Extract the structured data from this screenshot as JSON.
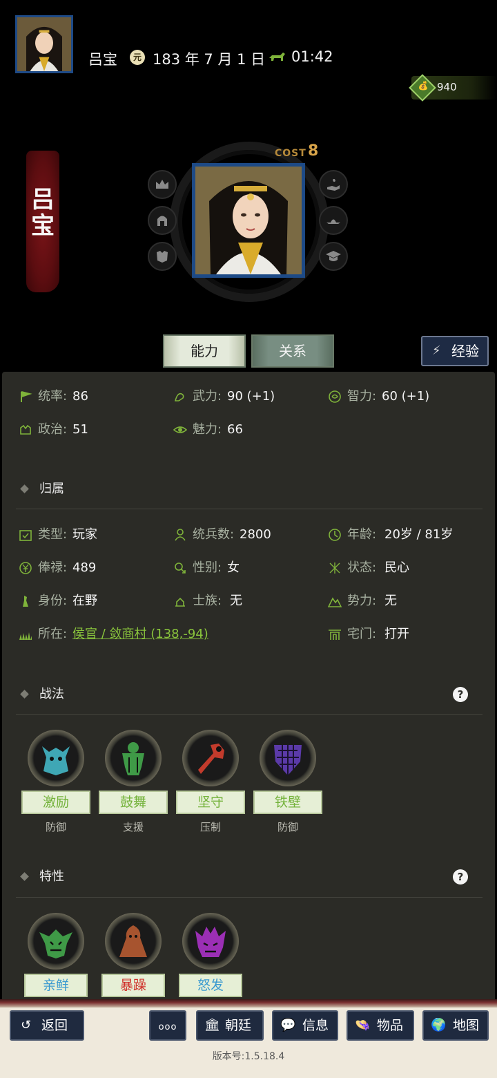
{
  "header": {
    "player_name": "吕宝",
    "date_icon_char": "元",
    "date": "183 年 7 月 1 日",
    "time": "01:42",
    "coin_value": "940"
  },
  "hero": {
    "name_banner": "吕宝",
    "cost_label": "COST",
    "cost_value": "8",
    "left_slots": [
      "crown-icon",
      "helmet-icon",
      "armor-icon"
    ],
    "right_slots": [
      "hand-seed-icon",
      "hat-icon",
      "mortarboard-icon"
    ]
  },
  "tabs": {
    "ability": "能力",
    "relation": "关系",
    "experience": "经验"
  },
  "stats": {
    "tongshuai": {
      "k": "统率: ",
      "v": "86"
    },
    "wuli": {
      "k": "武力: ",
      "v": "90 (+1)"
    },
    "zhili": {
      "k": "智力: ",
      "v": "60 (+1)"
    },
    "zhengzhi": {
      "k": "政治: ",
      "v": "51"
    },
    "meili": {
      "k": "魅力: ",
      "v": "66"
    }
  },
  "affiliation": {
    "title": "归属",
    "type": {
      "k": "类型: ",
      "v": "玩家"
    },
    "troops": {
      "k": "统兵数: ",
      "v": "2800"
    },
    "age": {
      "k": "年龄: ",
      "v": "20岁 / 81岁"
    },
    "salary": {
      "k": "俸禄: ",
      "v": "489"
    },
    "gender": {
      "k": "性别: ",
      "v": "女"
    },
    "status": {
      "k": "状态: ",
      "v": "民心"
    },
    "identity": {
      "k": "身份: ",
      "v": "在野"
    },
    "clan": {
      "k": "士族: ",
      "v": "无"
    },
    "faction": {
      "k": "势力: ",
      "v": "无"
    },
    "location": {
      "k": "所在: ",
      "v": "侯官 / 敛商村 (138,-94)"
    },
    "gate": {
      "k": "宅门: ",
      "v": "打开"
    }
  },
  "tactics": {
    "title": "战法",
    "help": "?",
    "items": [
      {
        "name": "激励",
        "category": "防御",
        "color": "#3fa7b5"
      },
      {
        "name": "鼓舞",
        "category": "支援",
        "color": "#3f9a47"
      },
      {
        "name": "坚守",
        "category": "压制",
        "color": "#c23b2c"
      },
      {
        "name": "铁壁",
        "category": "防御",
        "color": "#5b3aa8"
      }
    ]
  },
  "traits": {
    "title": "特性",
    "help": "?",
    "items": [
      {
        "name": "亲鲜",
        "color": "#3a9ad0"
      },
      {
        "name": "暴躁",
        "color": "#d0302a"
      },
      {
        "name": "怒发",
        "color": "#3a9ad0"
      }
    ]
  },
  "bottom_nav": {
    "back": "返回",
    "more": "ooo",
    "court": "朝廷",
    "info": "信息",
    "items": "物品",
    "map": "地图"
  },
  "version": "版本号:1.5.18.4"
}
